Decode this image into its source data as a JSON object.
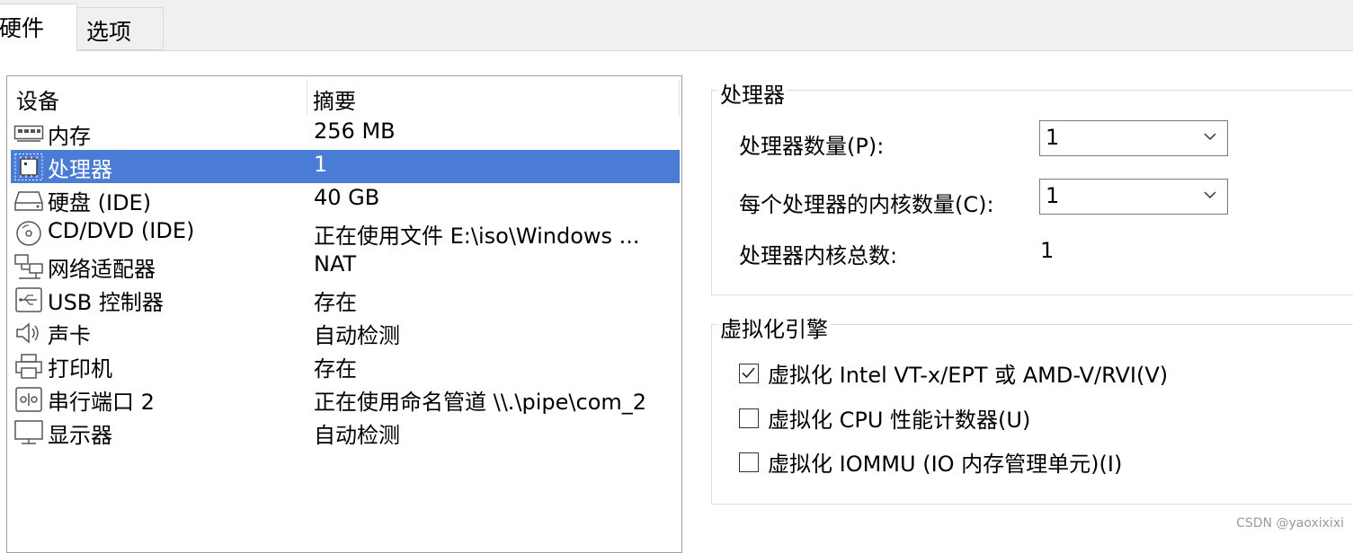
{
  "tabs": [
    {
      "label": "硬件",
      "active": true
    },
    {
      "label": "选项",
      "active": false
    }
  ],
  "device_list": {
    "headers": {
      "device": "设备",
      "summary": "摘要"
    },
    "rows": [
      {
        "icon": "memory-icon",
        "name": "内存",
        "summary": "256 MB",
        "selected": false
      },
      {
        "icon": "processor-icon",
        "name": "处理器",
        "summary": "1",
        "selected": true
      },
      {
        "icon": "hard-disk-icon",
        "name": "硬盘 (IDE)",
        "summary": "40 GB",
        "selected": false
      },
      {
        "icon": "cd-dvd-icon",
        "name": "CD/DVD (IDE)",
        "summary": "正在使用文件 E:\\iso\\Windows ...",
        "selected": false
      },
      {
        "icon": "network-adapter-icon",
        "name": "网络适配器",
        "summary": "NAT",
        "selected": false
      },
      {
        "icon": "usb-icon",
        "name": "USB 控制器",
        "summary": "存在",
        "selected": false
      },
      {
        "icon": "speaker-icon",
        "name": "声卡",
        "summary": "自动检测",
        "selected": false
      },
      {
        "icon": "printer-icon",
        "name": "打印机",
        "summary": "存在",
        "selected": false
      },
      {
        "icon": "serial-port-icon",
        "name": "串行端口 2",
        "summary": "正在使用命名管道 \\\\.\\pipe\\com_2",
        "selected": false
      },
      {
        "icon": "monitor-icon",
        "name": "显示器",
        "summary": "自动检测",
        "selected": false
      }
    ]
  },
  "processor_group": {
    "title": "处理器",
    "count_label": "处理器数量(P):",
    "count_value": "1",
    "cores_label": "每个处理器的内核数量(C):",
    "cores_value": "1",
    "total_label": "处理器内核总数:",
    "total_value": "1"
  },
  "virtualization_group": {
    "title": "虚拟化引擎",
    "options": [
      {
        "label": "虚拟化 Intel VT-x/EPT 或 AMD-V/RVI(V)",
        "checked": true
      },
      {
        "label": "虚拟化 CPU 性能计数器(U)",
        "checked": false
      },
      {
        "label": "虚拟化 IOMMU (IO 内存管理单元)(I)",
        "checked": false
      }
    ]
  },
  "watermark": "CSDN @yaoxixixi",
  "colors": {
    "selection": "#4a7cd6",
    "tab_bar": "#f0f0f0",
    "border": "#a0a0a0"
  }
}
